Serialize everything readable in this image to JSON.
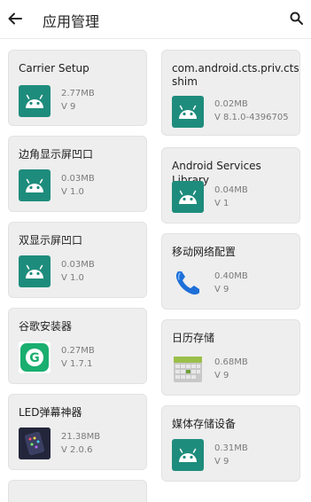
{
  "header": {
    "title": "应用管理"
  },
  "apps_left": [
    {
      "name": "Carrier Setup",
      "size": "2.77MB",
      "version": "V 9",
      "icon": "android-icon"
    },
    {
      "name": "边角显示屏凹口",
      "size": "0.03MB",
      "version": "V 1.0",
      "icon": "android-icon"
    },
    {
      "name": "双显示屏凹口",
      "size": "0.03MB",
      "version": "V 1.0",
      "icon": "android-icon"
    },
    {
      "name": "谷歌安装器",
      "size": "0.27MB",
      "version": "V 1.7.1",
      "icon": "google-installer-icon"
    },
    {
      "name": "LED弹幕神器",
      "size": "21.38MB",
      "version": "V 2.0.6",
      "icon": "led-marquee-icon"
    }
  ],
  "apps_right": [
    {
      "name_line1": "com.android.cts.priv.cts",
      "name_line2": "shim",
      "size": "0.02MB",
      "version": "V 8.1.0-4396705",
      "icon": "android-icon"
    },
    {
      "name": "Android Services Library",
      "size": "0.04MB",
      "version": "V 1",
      "icon": "android-icon"
    },
    {
      "name": "移动网络配置",
      "size": "0.40MB",
      "version": "V 9",
      "icon": "phone-icon"
    },
    {
      "name": "日历存储",
      "size": "0.68MB",
      "version": "V 9",
      "icon": "calendar-icon"
    },
    {
      "name": "媒体存储设备",
      "size": "0.31MB",
      "version": "V 9",
      "icon": "android-icon"
    }
  ],
  "colors": {
    "android_teal": "#1e8c7c",
    "card_bg": "#eeeeee",
    "phone_blue": "#1e6fd9",
    "google_green": "#1aae6f"
  }
}
